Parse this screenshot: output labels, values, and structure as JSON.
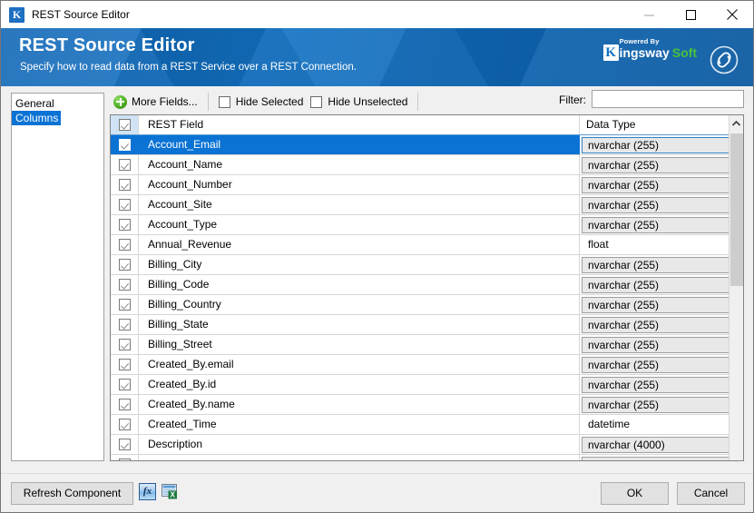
{
  "window": {
    "title": "REST Source Editor",
    "app_icon": "kingswaysoft-k-icon",
    "controls": {
      "minimize": "minimize-icon",
      "maximize": "maximize-icon",
      "close": "close-icon"
    }
  },
  "banner": {
    "title": "REST Source Editor",
    "subtitle": "Specify how to read data from a REST Service over a REST Connection.",
    "logo": {
      "mark": "K",
      "powered_by": "Powered By",
      "name_primary": "ingsway",
      "name_secondary": "Soft",
      "accent_green": "#49c23a"
    },
    "link_icon": "chain-link-icon",
    "background_color": "#1272c4"
  },
  "nav": {
    "items": [
      {
        "label": "General",
        "selected": false
      },
      {
        "label": "Columns",
        "selected": true
      }
    ],
    "selected_color": "#0a73d4"
  },
  "toolbar": {
    "more_fields_label": "More Fields...",
    "more_fields_icon": "green-plus-icon",
    "hide_selected_label": "Hide Selected",
    "hide_selected_checked": false,
    "hide_unselected_label": "Hide Unselected",
    "hide_unselected_checked": false,
    "filter_label": "Filter:",
    "filter_value": "",
    "filter_placeholder": ""
  },
  "grid": {
    "header": {
      "select_all_checked": true,
      "field_column": "REST Field",
      "type_column": "Data Type"
    },
    "rows": [
      {
        "checked": true,
        "field": "Account_Email",
        "type": "nvarchar (255)",
        "type_style": "button",
        "selected": true
      },
      {
        "checked": true,
        "field": "Account_Name",
        "type": "nvarchar (255)",
        "type_style": "button",
        "selected": false
      },
      {
        "checked": true,
        "field": "Account_Number",
        "type": "nvarchar (255)",
        "type_style": "button",
        "selected": false
      },
      {
        "checked": true,
        "field": "Account_Site",
        "type": "nvarchar (255)",
        "type_style": "button",
        "selected": false
      },
      {
        "checked": true,
        "field": "Account_Type",
        "type": "nvarchar (255)",
        "type_style": "button",
        "selected": false
      },
      {
        "checked": true,
        "field": "Annual_Revenue",
        "type": "float",
        "type_style": "plain",
        "selected": false
      },
      {
        "checked": true,
        "field": "Billing_City",
        "type": "nvarchar (255)",
        "type_style": "button",
        "selected": false
      },
      {
        "checked": true,
        "field": "Billing_Code",
        "type": "nvarchar (255)",
        "type_style": "button",
        "selected": false
      },
      {
        "checked": true,
        "field": "Billing_Country",
        "type": "nvarchar (255)",
        "type_style": "button",
        "selected": false
      },
      {
        "checked": true,
        "field": "Billing_State",
        "type": "nvarchar (255)",
        "type_style": "button",
        "selected": false
      },
      {
        "checked": true,
        "field": "Billing_Street",
        "type": "nvarchar (255)",
        "type_style": "button",
        "selected": false
      },
      {
        "checked": true,
        "field": "Created_By.email",
        "type": "nvarchar (255)",
        "type_style": "button",
        "selected": false
      },
      {
        "checked": true,
        "field": "Created_By.id",
        "type": "nvarchar (255)",
        "type_style": "button",
        "selected": false
      },
      {
        "checked": true,
        "field": "Created_By.name",
        "type": "nvarchar (255)",
        "type_style": "button",
        "selected": false
      },
      {
        "checked": true,
        "field": "Created_Time",
        "type": "datetime",
        "type_style": "plain",
        "selected": false
      },
      {
        "checked": true,
        "field": "Description",
        "type": "nvarchar (4000)",
        "type_style": "button",
        "selected": false
      },
      {
        "checked": true,
        "field": "",
        "type": "",
        "type_style": "button",
        "selected": false
      }
    ],
    "scrollbar": {
      "up_arrow_icon": "chevron-up-icon",
      "thumb_top_pct": 0,
      "thumb_height_pct": 45
    }
  },
  "footer": {
    "refresh_label": "Refresh Component",
    "fx_icon": "fx-expression-icon",
    "fx_icon_label": "fx",
    "export_icon": "excel-export-icon",
    "ok_label": "OK",
    "cancel_label": "Cancel"
  }
}
